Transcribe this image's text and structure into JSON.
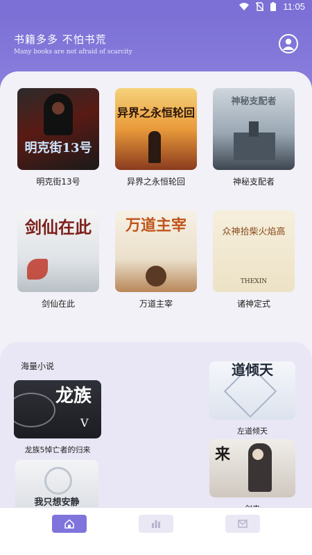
{
  "status": {
    "time": "11:05",
    "icons": [
      "wifi-icon",
      "no-sim-icon",
      "battery-icon"
    ]
  },
  "header": {
    "title": "书籍多多 不怕书荒",
    "subtitle": "Many books are not afraid of scarcity",
    "avatar_icon": "user-icon"
  },
  "books": [
    {
      "title": "明克街13号",
      "cover_text": "明克街13号"
    },
    {
      "title": "异界之永恒轮回",
      "cover_text": "异界之永恒轮回"
    },
    {
      "title": "神秘支配者",
      "cover_text": "神秘支配者"
    },
    {
      "title": "剑仙在此",
      "cover_text": "剑仙在此"
    },
    {
      "title": "万道主宰",
      "cover_text": "万道主宰"
    },
    {
      "title": "诸神定式",
      "cover_text": "众神拾柴火焰高",
      "cover_sub": "THEXIN"
    }
  ],
  "section": {
    "title": "海量小说",
    "items": [
      {
        "title": "龙族5悼亡者的归来",
        "cover_text": "龙族",
        "cover_mark": "V"
      },
      {
        "title": "左道倾天",
        "cover_text": "道倾天"
      },
      {
        "title": "",
        "cover_text": "我只想安静"
      },
      {
        "title": "剑来",
        "cover_text": "来"
      }
    ]
  },
  "tabs": [
    {
      "icon": "home-icon",
      "active": true
    },
    {
      "icon": "chart-icon",
      "active": false
    },
    {
      "icon": "mail-icon",
      "active": false
    }
  ],
  "colors": {
    "accent": "#7f74dc",
    "header": "#7c70d6",
    "panel": "#f2f1f7"
  }
}
